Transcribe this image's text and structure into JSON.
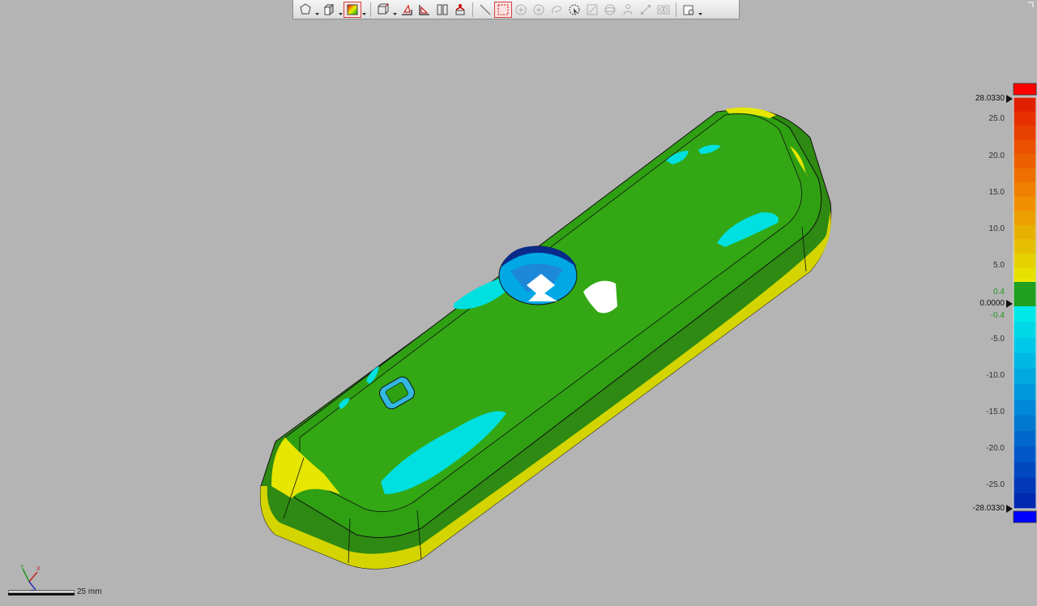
{
  "toolbar": {
    "tools": [
      {
        "name": "view-shape",
        "icon": "polygon-icon",
        "dropdown": true
      },
      {
        "name": "view-cube",
        "icon": "cube-icon",
        "dropdown": true
      },
      {
        "name": "color-map",
        "icon": "colormap-icon",
        "dropdown": true,
        "active": true
      },
      {
        "name": "section-view",
        "icon": "section-box-icon",
        "dropdown": true
      },
      {
        "name": "front-view",
        "icon": "front-view-icon"
      },
      {
        "name": "side-view",
        "icon": "side-view-icon"
      },
      {
        "name": "split-view",
        "icon": "split-view-icon"
      },
      {
        "name": "person-view",
        "icon": "person-view-icon"
      },
      {
        "name": "line-tool",
        "icon": "line-icon"
      },
      {
        "name": "rect-select",
        "icon": "rect-select-icon",
        "active": true
      },
      {
        "name": "add-point",
        "icon": "add-point-icon",
        "disabled": true
      },
      {
        "name": "add-point-2",
        "icon": "add-point-alt-icon",
        "disabled": true
      },
      {
        "name": "lasso",
        "icon": "lasso-icon",
        "disabled": true
      },
      {
        "name": "circle-select",
        "icon": "circle-select-icon"
      },
      {
        "name": "brush",
        "icon": "brush-icon",
        "disabled": true
      },
      {
        "name": "sphere",
        "icon": "sphere-icon",
        "disabled": true
      },
      {
        "name": "person-select",
        "icon": "person-select-icon",
        "disabled": true
      },
      {
        "name": "flip",
        "icon": "flip-icon",
        "disabled": true
      },
      {
        "name": "visibility",
        "icon": "eye-icon",
        "disabled": true
      },
      {
        "name": "display-options",
        "icon": "display-options-icon",
        "dropdown": true
      }
    ]
  },
  "legend": {
    "max_value": "28.0330",
    "min_value": "-28.0330",
    "zero_value": "0.0000",
    "tolerance_upper": "0.4",
    "tolerance_lower": "-0.4",
    "ticks": [
      "25.0",
      "20.0",
      "15.0",
      "10.0",
      "5.0",
      "-5.0",
      "-10.0",
      "-15.0",
      "-20.0",
      "-25.0"
    ],
    "colors": {
      "over": "#ff0000",
      "under": "#0000ff",
      "tolerance": "#1fa01f"
    }
  },
  "scale": {
    "label": "25 mm"
  },
  "axes": {
    "y": "Y",
    "x": "X",
    "z": "Z"
  }
}
